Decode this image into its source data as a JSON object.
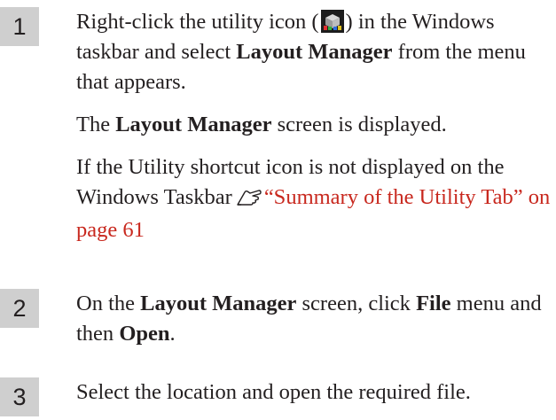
{
  "steps": [
    {
      "number": "1",
      "line1_pre": "Right-click the utility icon (",
      "line1_post": ") in the Windows taskbar and select ",
      "bold1": "Layout Manager",
      "line1_end": " from the menu that appears.",
      "para2_pre": "The ",
      "para2_bold": "Layout Manager",
      "para2_post": " screen is displayed.",
      "para3_text": "If the Utility shortcut icon is not displayed on the Windows Taskbar",
      "para3_link": "“Summary of the Utility Tab” on page 61"
    },
    {
      "number": "2",
      "pre": "On the ",
      "bold1": "Layout Manager",
      "mid1": " screen, click ",
      "bold2": "File",
      "mid2": " menu and then ",
      "bold3": "Open",
      "end": "."
    },
    {
      "number": "3",
      "text": "Select the location and open the required file."
    }
  ],
  "icons": {
    "utility": "utility-printer-icon",
    "reference": "hand-pointer-reference-icon"
  }
}
